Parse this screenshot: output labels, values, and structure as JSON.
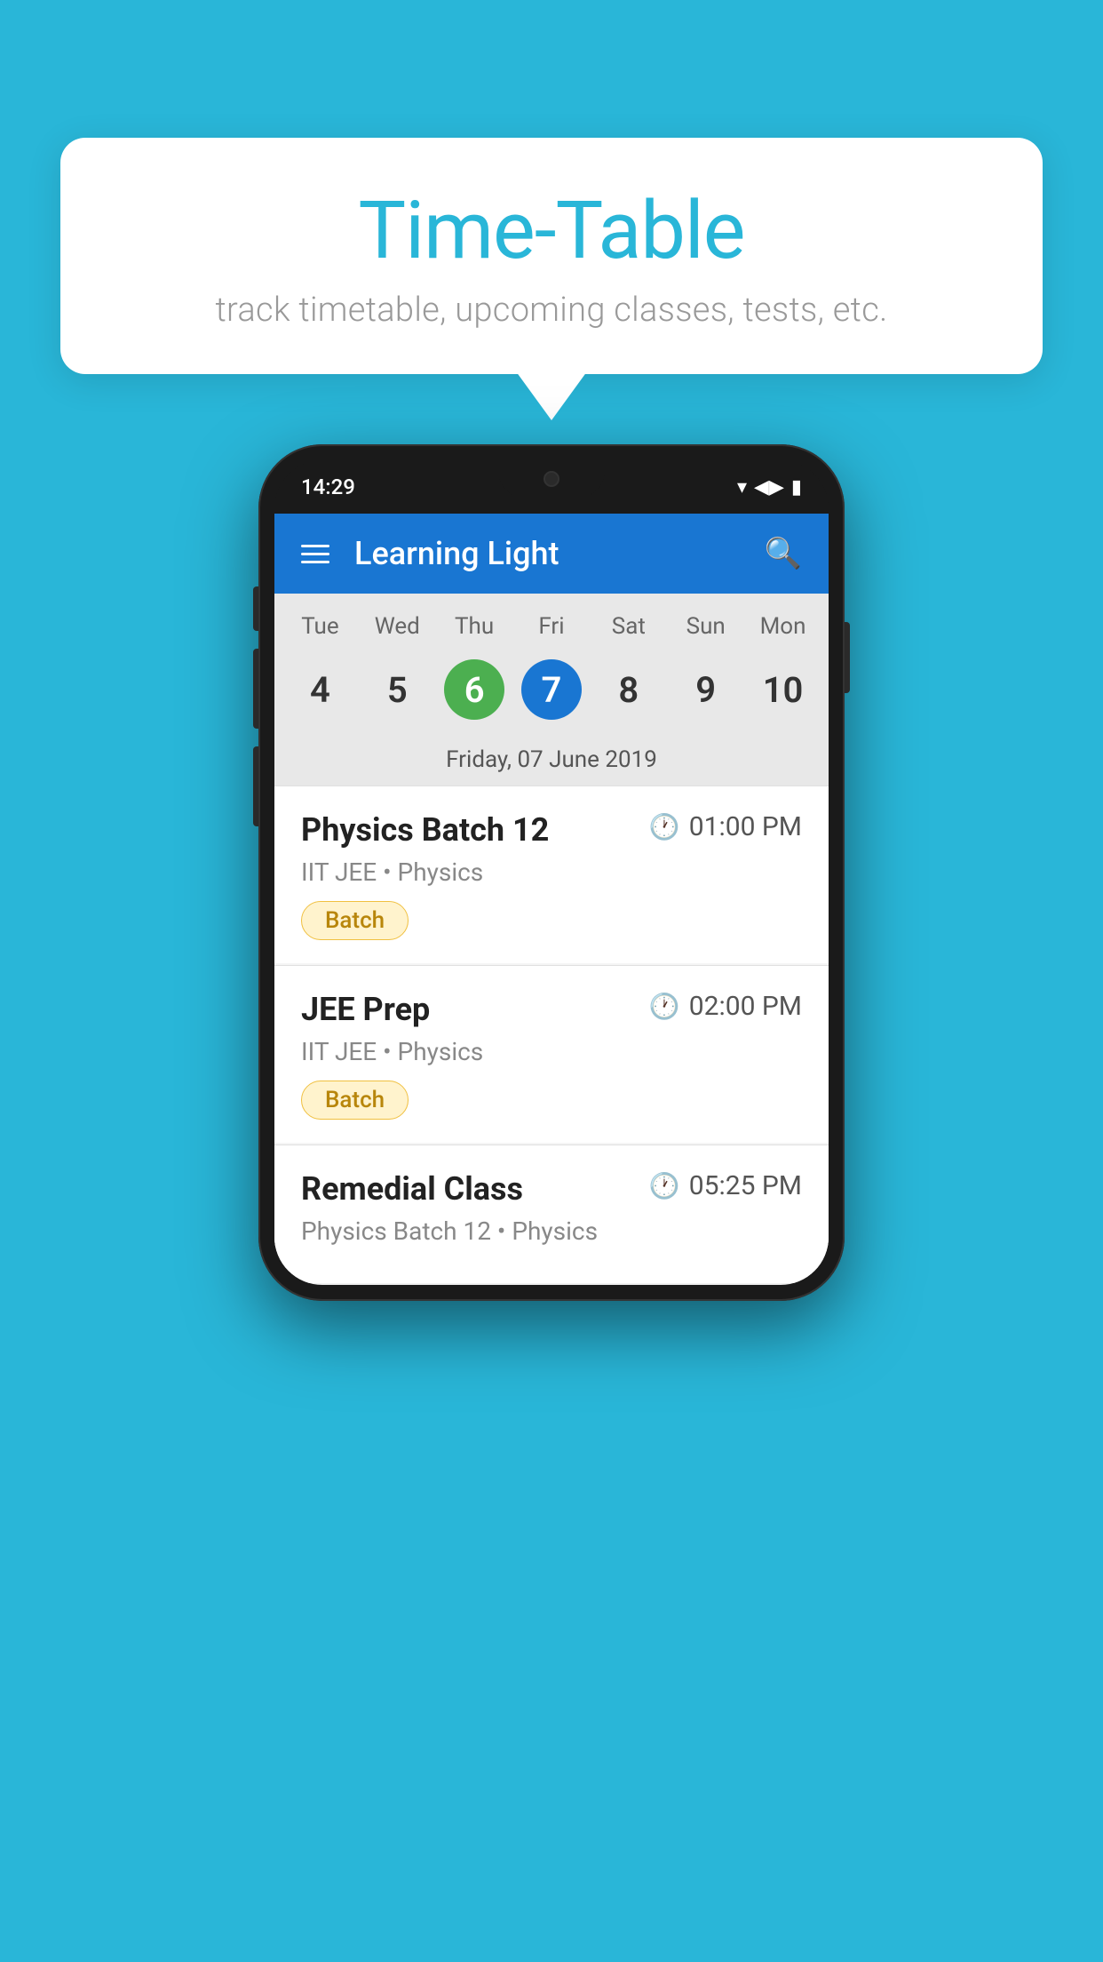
{
  "background_color": "#29b6d8",
  "speech_bubble": {
    "title": "Time-Table",
    "subtitle": "track timetable, upcoming classes, tests, etc."
  },
  "phone": {
    "status_bar": {
      "time": "14:29",
      "wifi": "▾",
      "signal": "▴▴",
      "battery": "▮"
    },
    "app_bar": {
      "title": "Learning Light"
    },
    "calendar": {
      "weekdays": [
        "Tue",
        "Wed",
        "Thu",
        "Fri",
        "Sat",
        "Sun",
        "Mon"
      ],
      "dates": [
        "4",
        "5",
        "6",
        "7",
        "8",
        "9",
        "10"
      ],
      "today_index": 2,
      "selected_index": 3,
      "selected_date_label": "Friday, 07 June 2019"
    },
    "schedule": [
      {
        "title": "Physics Batch 12",
        "time": "01:00 PM",
        "subtitle": "IIT JEE • Physics",
        "tag": "Batch"
      },
      {
        "title": "JEE Prep",
        "time": "02:00 PM",
        "subtitle": "IIT JEE • Physics",
        "tag": "Batch"
      },
      {
        "title": "Remedial Class",
        "time": "05:25 PM",
        "subtitle": "Physics Batch 12 • Physics",
        "tag": ""
      }
    ]
  }
}
